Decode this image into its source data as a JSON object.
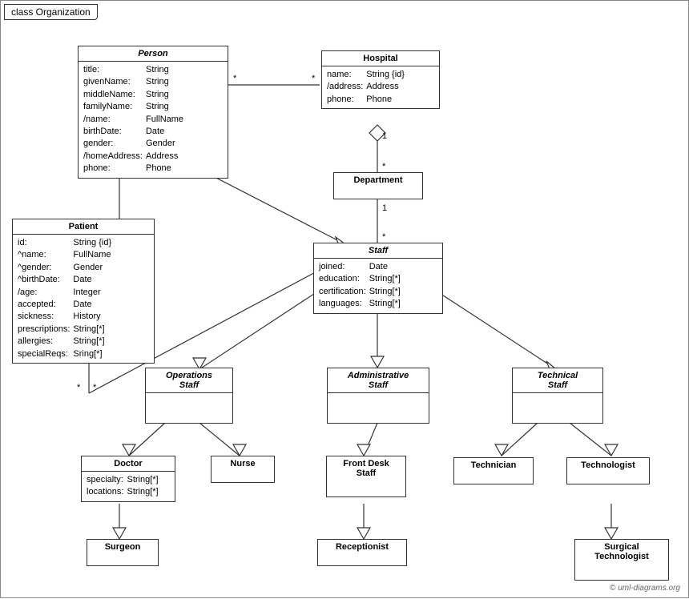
{
  "diagram": {
    "title": "class Organization",
    "copyright": "© uml-diagrams.org",
    "classes": {
      "person": {
        "name": "Person",
        "italic": true,
        "attrs": [
          [
            "title:",
            "String"
          ],
          [
            "givenName:",
            "String"
          ],
          [
            "middleName:",
            "String"
          ],
          [
            "familyName:",
            "String"
          ],
          [
            "/name:",
            "FullName"
          ],
          [
            "birthDate:",
            "Date"
          ],
          [
            "gender:",
            "Gender"
          ],
          [
            "/homeAddress:",
            "Address"
          ],
          [
            "phone:",
            "Phone"
          ]
        ]
      },
      "hospital": {
        "name": "Hospital",
        "italic": false,
        "attrs": [
          [
            "name:",
            "String {id}"
          ],
          [
            "/address:",
            "Address"
          ],
          [
            "phone:",
            "Phone"
          ]
        ]
      },
      "patient": {
        "name": "Patient",
        "italic": false,
        "attrs": [
          [
            "id:",
            "String {id}"
          ],
          [
            "^name:",
            "FullName"
          ],
          [
            "^gender:",
            "Gender"
          ],
          [
            "^birthDate:",
            "Date"
          ],
          [
            "/age:",
            "Integer"
          ],
          [
            "accepted:",
            "Date"
          ],
          [
            "sickness:",
            "History"
          ],
          [
            "prescriptions:",
            "String[*]"
          ],
          [
            "allergies:",
            "String[*]"
          ],
          [
            "specialReqs:",
            "Sring[*]"
          ]
        ]
      },
      "department": {
        "name": "Department",
        "italic": false,
        "attrs": []
      },
      "staff": {
        "name": "Staff",
        "italic": true,
        "attrs": [
          [
            "joined:",
            "Date"
          ],
          [
            "education:",
            "String[*]"
          ],
          [
            "certification:",
            "String[*]"
          ],
          [
            "languages:",
            "String[*]"
          ]
        ]
      },
      "operations_staff": {
        "name": "Operations\nStaff",
        "italic": true,
        "attrs": []
      },
      "administrative_staff": {
        "name": "Administrative\nStaff",
        "italic": true,
        "attrs": []
      },
      "technical_staff": {
        "name": "Technical\nStaff",
        "italic": true,
        "attrs": []
      },
      "doctor": {
        "name": "Doctor",
        "italic": false,
        "attrs": [
          [
            "specialty:",
            "String[*]"
          ],
          [
            "locations:",
            "String[*]"
          ]
        ]
      },
      "nurse": {
        "name": "Nurse",
        "italic": false,
        "attrs": []
      },
      "front_desk_staff": {
        "name": "Front Desk\nStaff",
        "italic": false,
        "attrs": []
      },
      "technician": {
        "name": "Technician",
        "italic": false,
        "attrs": []
      },
      "technologist": {
        "name": "Technologist",
        "italic": false,
        "attrs": []
      },
      "surgeon": {
        "name": "Surgeon",
        "italic": false,
        "attrs": []
      },
      "receptionist": {
        "name": "Receptionist",
        "italic": false,
        "attrs": []
      },
      "surgical_technologist": {
        "name": "Surgical\nTechnologist",
        "italic": false,
        "attrs": []
      }
    }
  }
}
